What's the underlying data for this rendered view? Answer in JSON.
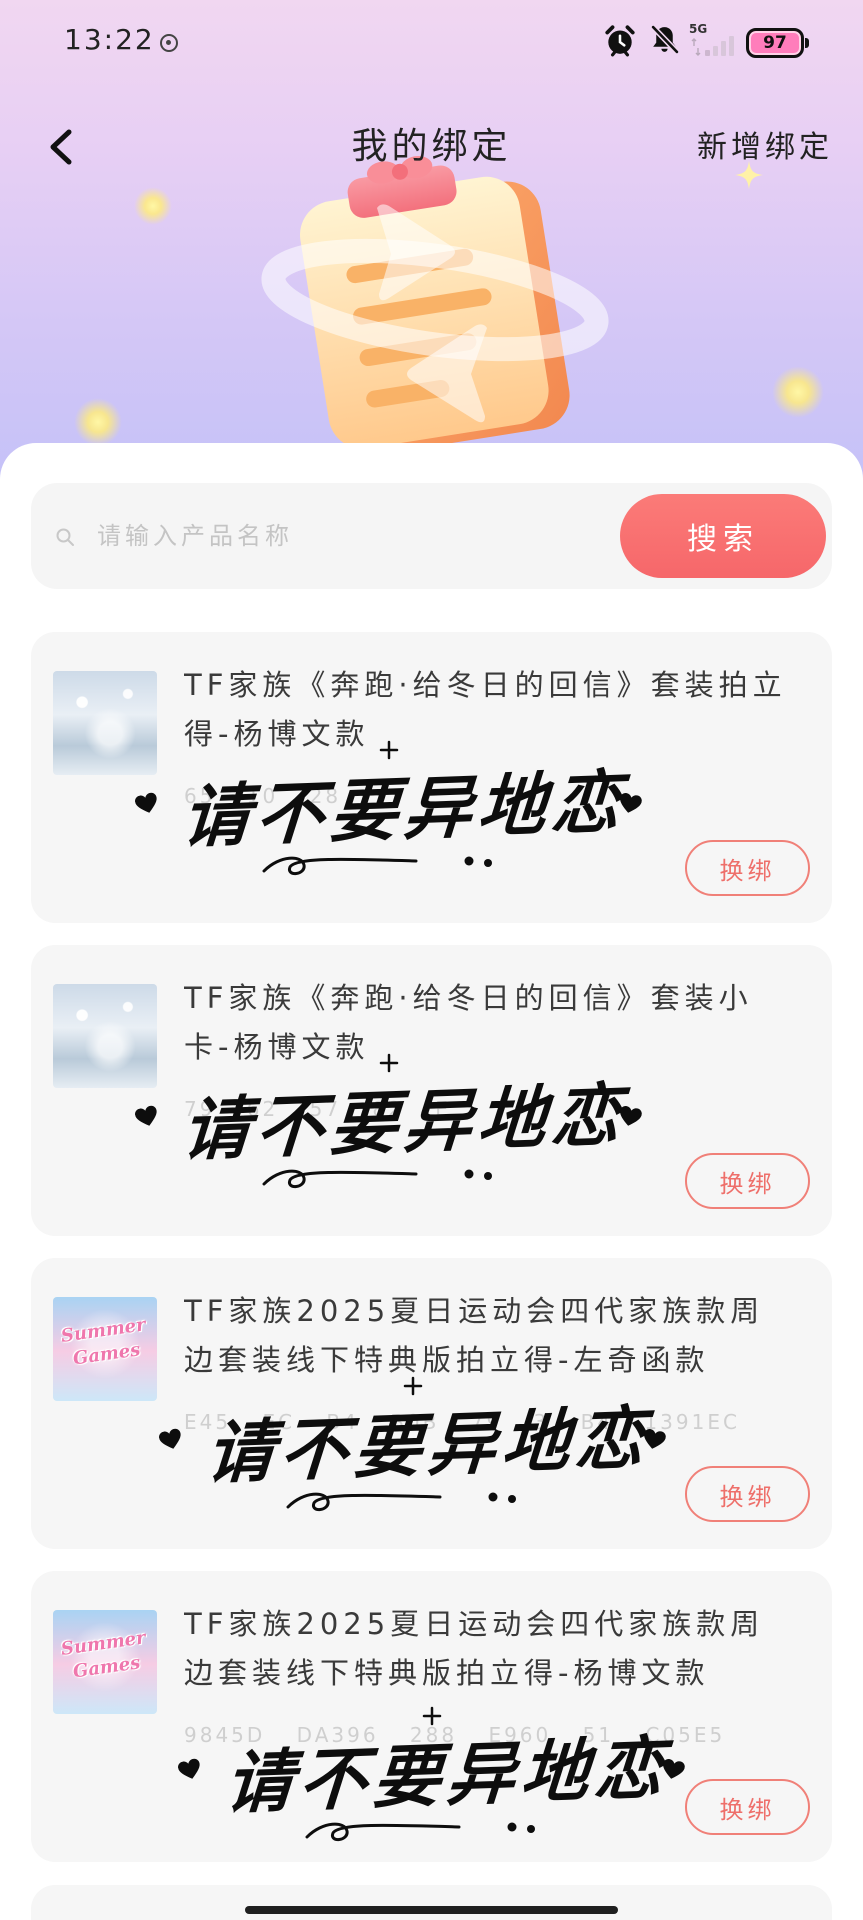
{
  "status_bar": {
    "time": "13:22",
    "network": "5G",
    "battery": "97",
    "icons": [
      "notification-icon",
      "alarm-icon",
      "bell-slash-icon",
      "signal-icon",
      "battery-icon"
    ]
  },
  "header": {
    "back_icon": "chevron-left-icon",
    "title": "我的绑定",
    "action_label": "新增绑定"
  },
  "search": {
    "icon": "search-icon",
    "placeholder": "请输入产品名称",
    "value": "",
    "button_label": "搜索"
  },
  "bindings": [
    {
      "thumbnail": "winter-artwork",
      "title": "TF家族《奔跑·给冬日的回信》套装拍立得-杨博文款",
      "code": "65 10 28",
      "action_label": "换绑"
    },
    {
      "thumbnail": "winter-artwork",
      "title": "TF家族《奔跑·给冬日的回信》套装小卡-杨博文款",
      "code": "79 62 57 82 E",
      "action_label": "换绑"
    },
    {
      "thumbnail": "summer-games-artwork",
      "thumbnail_text": "Summer Games",
      "title": "TF家族2025夏日运动会四代家族款周边套装线下特典版拍立得-左奇函款",
      "code": "E45 EC B4 B0B 79 3 B4 1391EC",
      "action_label": "换绑"
    },
    {
      "thumbnail": "summer-games-artwork",
      "thumbnail_text": "Summer Games",
      "title": "TF家族2025夏日运动会四代家族款周边套装线下特典版拍立得-杨博文款",
      "code": "9845D DA396 288 E960 51 C05E5",
      "action_label": "换绑"
    }
  ],
  "sticker": {
    "text": "请不要异地恋",
    "icons": [
      "heart-icon",
      "plus-mark",
      "dots-mark"
    ]
  },
  "colors": {
    "accent": "#f8716f",
    "header_gradient_top": "#f1d7f1",
    "header_gradient_bottom": "#c3c1f8",
    "card_background": "#f6f6f6",
    "title_text": "#3a3a3a",
    "muted_text": "#cfcfcf",
    "sticker_ink": "#0d0d0d"
  }
}
